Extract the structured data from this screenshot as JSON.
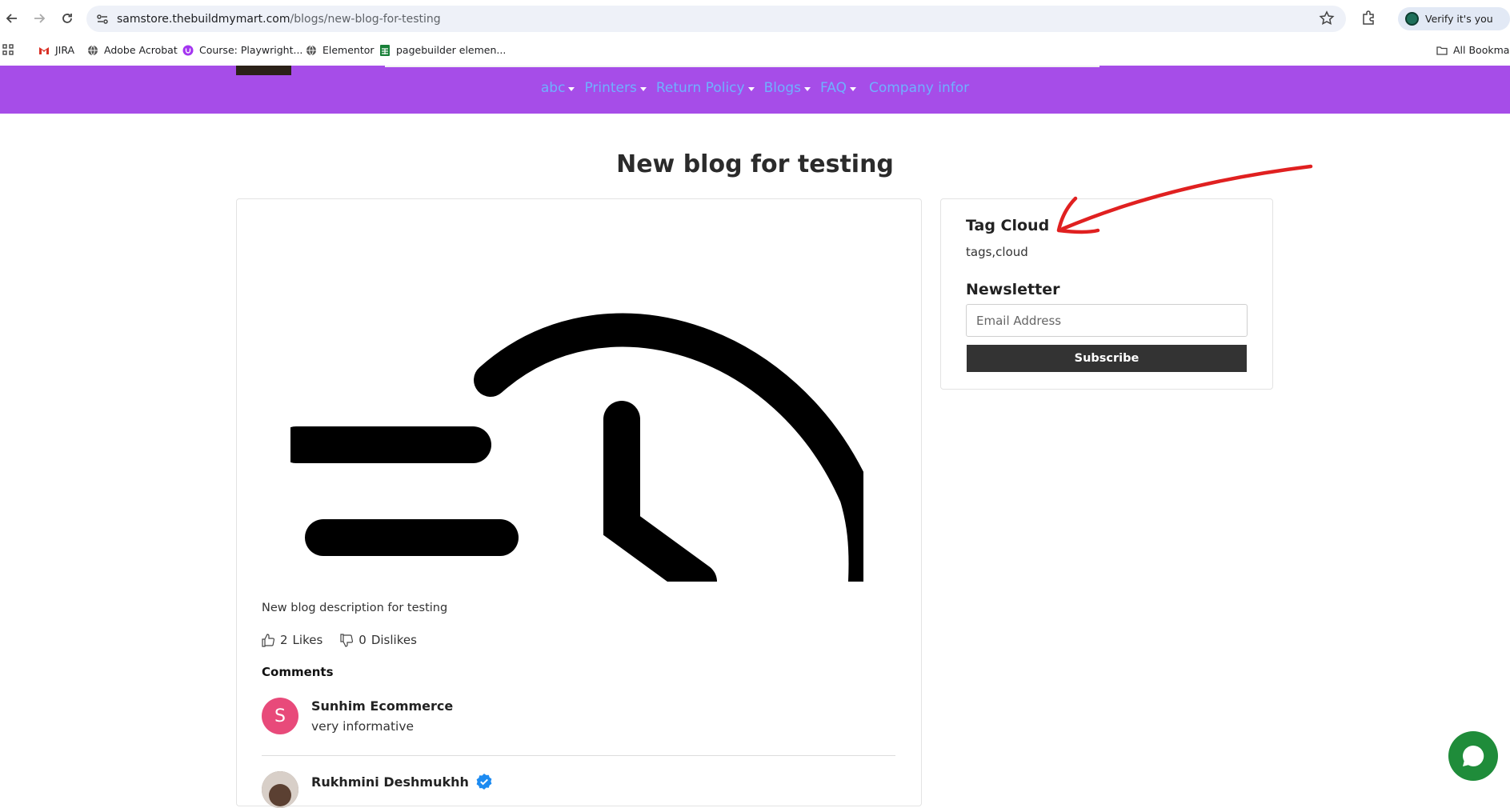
{
  "browser": {
    "url_host": "samstore.thebuildmymart.com",
    "url_path": "/blogs/new-blog-for-testing",
    "profile_label": "Verify it's you",
    "bookmarks": [
      "JIRA",
      "Adobe Acrobat",
      "Course: Playwright...",
      "Elementor",
      "pagebuilder elemen..."
    ],
    "all_bookmarks": "All Bookmarks"
  },
  "site": {
    "menu": [
      {
        "label": "abc",
        "caret": true
      },
      {
        "label": "Printers",
        "caret": true
      },
      {
        "label": "Return Policy",
        "caret": true
      },
      {
        "label": "Blogs",
        "caret": true
      },
      {
        "label": "FAQ",
        "caret": true
      },
      {
        "label": "Company infor",
        "caret": false
      }
    ],
    "nav_color": "#a64de8",
    "menu_color": "#6fb1ff"
  },
  "post": {
    "title": "New blog for testing",
    "image_icon": "history-clock-icon",
    "description": "New blog description for testing",
    "likes_count": "2",
    "likes_label": "Likes",
    "dislikes_count": "0",
    "dislikes_label": "Dislikes"
  },
  "comments": {
    "heading": "Comments",
    "items": [
      {
        "initial": "S",
        "name": "Sunhim Ecommerce",
        "text": "very informative",
        "avatar_color": "#e84a7a"
      },
      {
        "name": "Rukhmini Deshmukhh",
        "verified": true
      }
    ]
  },
  "sidebar": {
    "tag_cloud_heading": "Tag Cloud",
    "tags": "tags,cloud",
    "newsletter_heading": "Newsletter",
    "email_placeholder": "Email Address",
    "subscribe_label": "Subscribe"
  },
  "annotation": {
    "color": "#e02020",
    "icon": "red-arrow-annotation"
  }
}
